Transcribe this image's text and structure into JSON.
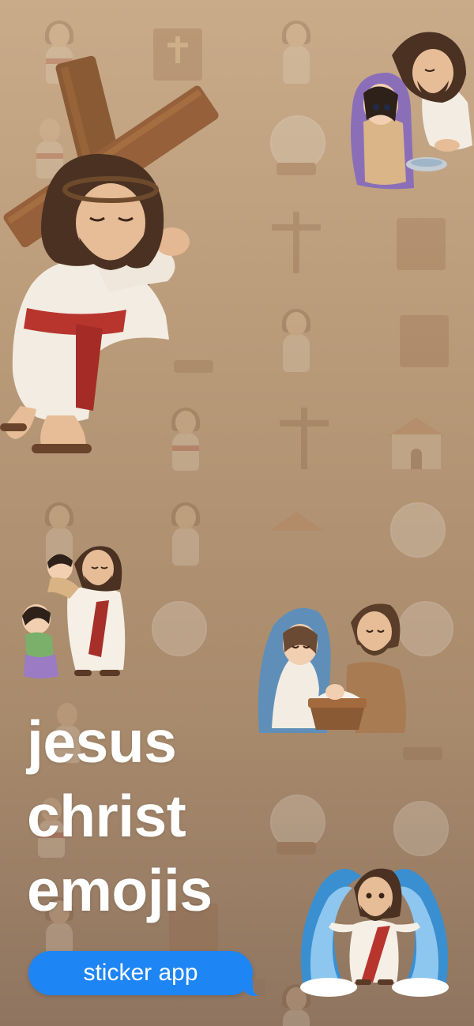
{
  "headline": {
    "line1": "jesus",
    "line2": "christ",
    "line3": "emojis"
  },
  "badge": {
    "label": "sticker app"
  },
  "colors": {
    "background_top": "#c9ab8a",
    "background_bottom": "#8f7560",
    "badge": "#1e85f5",
    "headline_text": "#ffffff"
  },
  "stickers": [
    {
      "name": "jesus-carrying-cross-sticker"
    },
    {
      "name": "woman-washing-feet-sticker"
    },
    {
      "name": "jesus-with-children-sticker"
    },
    {
      "name": "nativity-scene-sticker"
    },
    {
      "name": "jesus-parting-sea-sticker"
    }
  ]
}
